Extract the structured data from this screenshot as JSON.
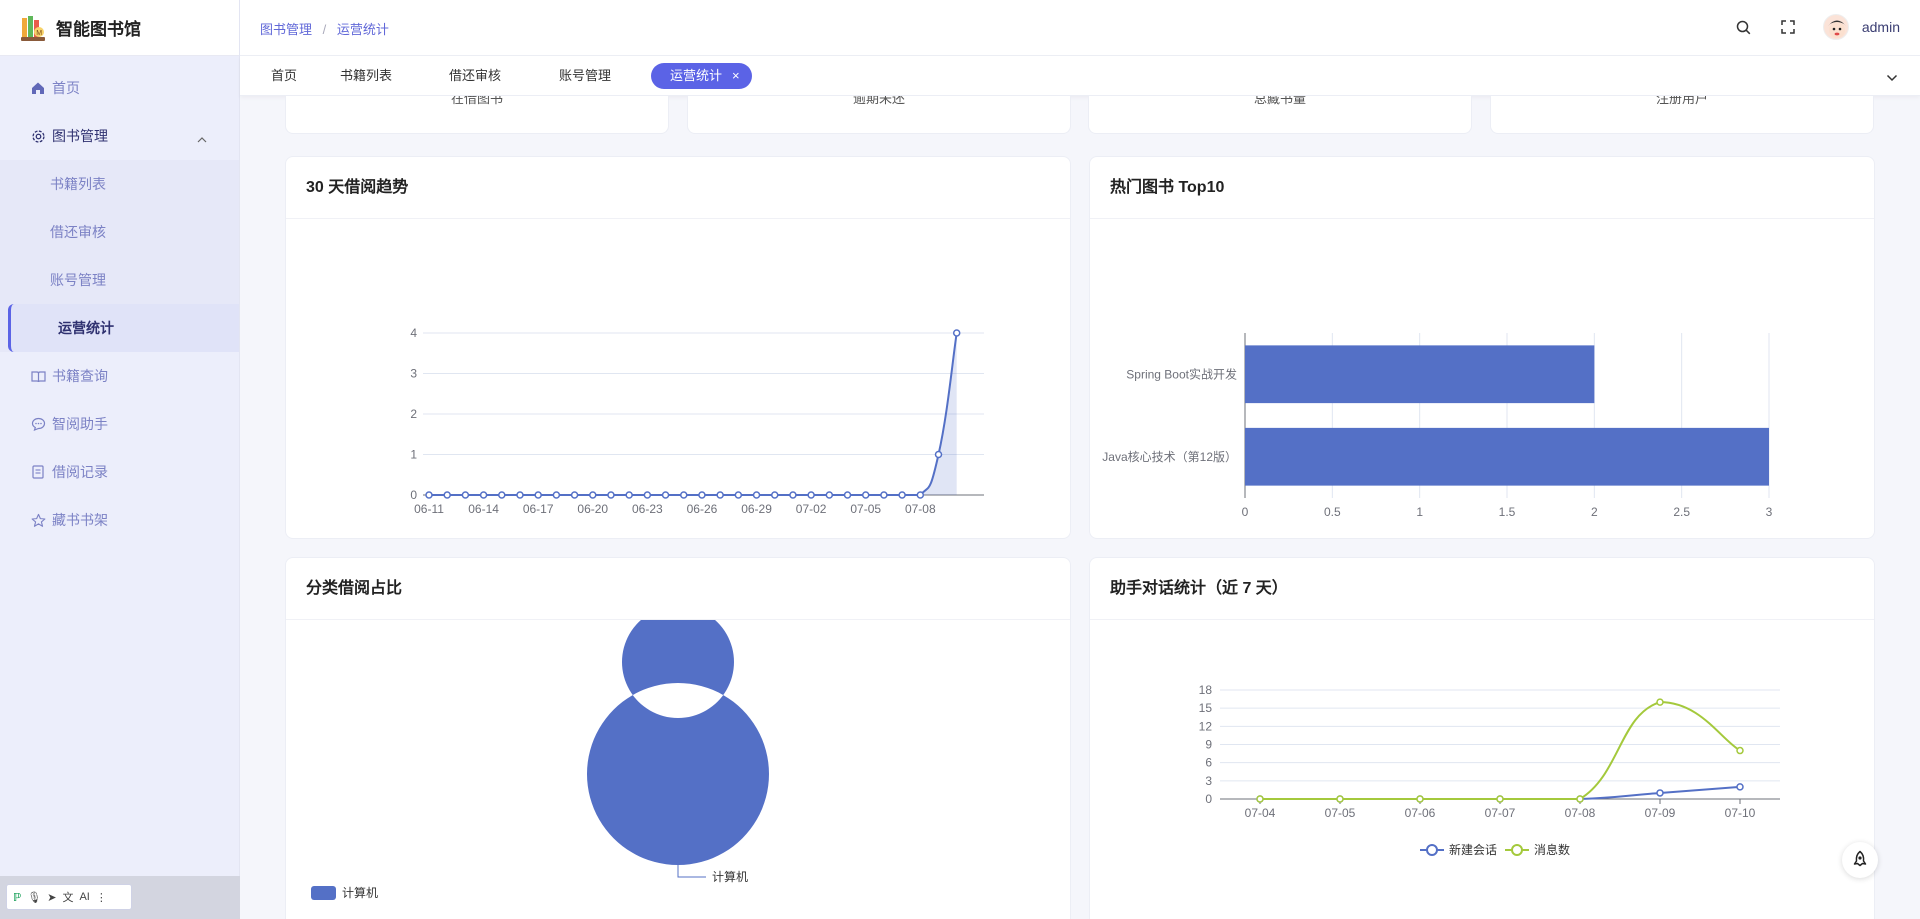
{
  "brand": {
    "title": "智能图书馆"
  },
  "sidebar": {
    "home": "首页",
    "group": "图书管理",
    "sub": [
      "书籍列表",
      "借还审核",
      "账号管理",
      "运营统计"
    ],
    "items": [
      "书籍查询",
      "智阅助手",
      "借阅记录",
      "藏书书架"
    ]
  },
  "ime": {
    "label": "AI"
  },
  "header": {
    "breadcrumb": [
      "图书管理",
      "运营统计"
    ],
    "username": "admin"
  },
  "tabs": [
    "首页",
    "书籍列表",
    "借还审核",
    "账号管理",
    "运营统计"
  ],
  "stats": [
    "在借图书",
    "逾期未还",
    "总藏书量",
    "注册用户"
  ],
  "panels": {
    "trend": "30 天借阅趋势",
    "top10": "热门图书 Top10",
    "category": "分类借阅占比",
    "assistant": "助手对话统计（近 7 天）"
  },
  "colors": {
    "accent": "#5b63e6",
    "series_blue": "#5470c6",
    "series_green": "#a4c93c"
  },
  "chart_data": [
    {
      "type": "area",
      "title": "30 天借阅趋势",
      "x": [
        "06-11",
        "06-12",
        "06-13",
        "06-14",
        "06-15",
        "06-16",
        "06-17",
        "06-18",
        "06-19",
        "06-20",
        "06-21",
        "06-22",
        "06-23",
        "06-24",
        "06-25",
        "06-26",
        "06-27",
        "06-28",
        "06-29",
        "06-30",
        "07-01",
        "07-02",
        "07-03",
        "07-04",
        "07-05",
        "07-06",
        "07-07",
        "07-08",
        "07-09",
        "07-10"
      ],
      "x_tick_labels": [
        "06-11",
        "06-14",
        "06-17",
        "06-20",
        "06-23",
        "06-26",
        "06-29",
        "07-02",
        "07-05",
        "07-08"
      ],
      "values": [
        0,
        0,
        0,
        0,
        0,
        0,
        0,
        0,
        0,
        0,
        0,
        0,
        0,
        0,
        0,
        0,
        0,
        0,
        0,
        0,
        0,
        0,
        0,
        0,
        0,
        0,
        0,
        0,
        1,
        4
      ],
      "ylim": [
        0,
        4
      ],
      "yticks": [
        0,
        1,
        2,
        3,
        4
      ]
    },
    {
      "type": "bar",
      "orientation": "horizontal",
      "title": "热门图书 Top10",
      "categories": [
        "Java核心技术（第12版）",
        "Spring Boot实战开发"
      ],
      "values": [
        3,
        2
      ],
      "xlim": [
        0,
        3
      ],
      "xticks": [
        "0",
        "0.5",
        "1",
        "1.5",
        "2",
        "2.5",
        "3"
      ]
    },
    {
      "type": "pie",
      "title": "分类借阅占比",
      "slices": [
        {
          "name": "计算机",
          "value": 1
        }
      ],
      "legend": [
        "计算机"
      ]
    },
    {
      "type": "line",
      "title": "助手对话统计（近 7 天）",
      "categories": [
        "07-04",
        "07-05",
        "07-06",
        "07-07",
        "07-08",
        "07-09",
        "07-10"
      ],
      "series": [
        {
          "name": "新建会话",
          "values": [
            0,
            0,
            0,
            0,
            0,
            1,
            2
          ]
        },
        {
          "name": "消息数",
          "values": [
            0,
            0,
            0,
            0,
            0,
            16,
            8
          ]
        }
      ],
      "ylim": [
        0,
        18
      ],
      "yticks": [
        0,
        3,
        6,
        9,
        12,
        15,
        18
      ],
      "legend": "bottom-center"
    }
  ]
}
